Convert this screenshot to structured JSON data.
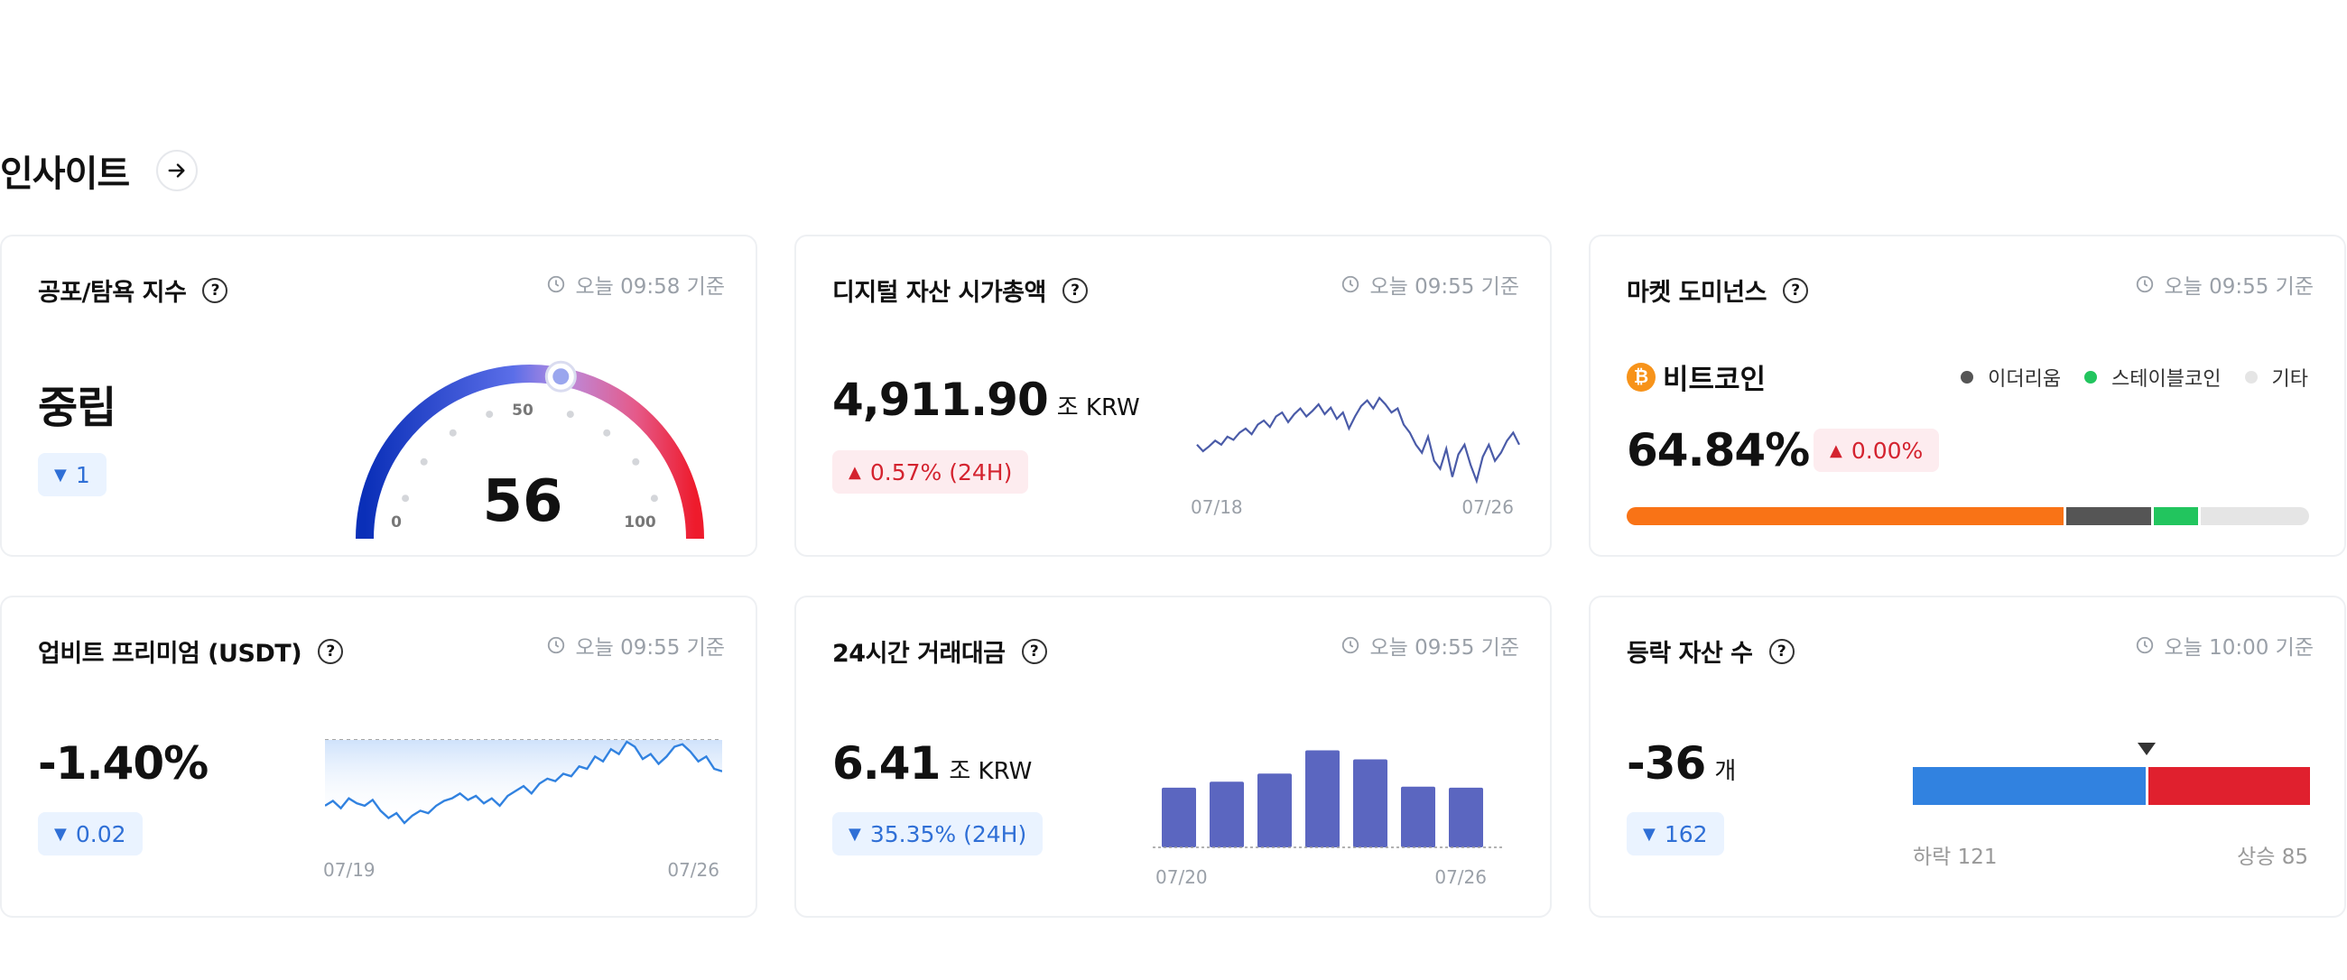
{
  "section": {
    "title": "인사이트",
    "arrow_icon": "arrow-right-icon"
  },
  "fear_greed": {
    "title": "공포/탐욕 지수",
    "timestamp": "오늘 09:58 기준",
    "state": "중립",
    "value": "56",
    "value_num": 56,
    "change": "1",
    "gauge_labels": {
      "min": "0",
      "mid": "50",
      "max": "100"
    }
  },
  "market_cap": {
    "title": "디지털 자산 시가총액",
    "timestamp": "오늘 09:55 기준",
    "value": "4,911.90",
    "unit": "조 KRW",
    "change": "0.57% (24H)",
    "x_start": "07/18",
    "x_end": "07/26"
  },
  "dominance": {
    "title": "마켓 도미넌스",
    "timestamp": "오늘 09:55 기준",
    "coin": "비트코인",
    "value": "64.84%",
    "change": "0.00%",
    "legend": [
      {
        "label": "이더리움",
        "color": "#555555"
      },
      {
        "label": "스테이블코인",
        "color": "#22c55e"
      },
      {
        "label": "기타",
        "color": "#e5e5e5"
      }
    ],
    "segments": [
      {
        "name": "비트코인",
        "share": 64.84,
        "color": "#f97316"
      },
      {
        "name": "이더리움",
        "share": 12.5,
        "color": "#555555"
      },
      {
        "name": "스테이블코인",
        "share": 6.6,
        "color": "#22c55e"
      },
      {
        "name": "기타",
        "share": 16.06,
        "color": "#e5e5e5"
      }
    ]
  },
  "premium": {
    "title": "업비트 프리미엄 (USDT)",
    "timestamp": "오늘 09:55 기준",
    "value": "-1.40%",
    "change": "0.02",
    "x_start": "07/19",
    "x_end": "07/26"
  },
  "volume": {
    "title": "24시간 거래대금",
    "timestamp": "오늘 09:55 기준",
    "value": "6.41",
    "unit": "조 KRW",
    "change": "35.35% (24H)",
    "x_start": "07/20",
    "x_end": "07/26"
  },
  "updown": {
    "title": "등락 자산 수",
    "timestamp": "오늘 10:00 기준",
    "value": "-36",
    "unit": "개",
    "change": "162",
    "down_label": "하락 121",
    "up_label": "상승 85",
    "down_count": 121,
    "up_count": 85,
    "down_color": "#3182e0",
    "up_color": "#e0202e"
  },
  "chart_data": [
    {
      "type": "line",
      "chart": "market_cap_trend",
      "x_ticks": [
        "07/18",
        "07/26"
      ],
      "y": [
        4880,
        4872,
        4878,
        4885,
        4880,
        4890,
        4886,
        4895,
        4900,
        4893,
        4905,
        4910,
        4902,
        4915,
        4920,
        4908,
        4918,
        4925,
        4915,
        4922,
        4930,
        4918,
        4926,
        4912,
        4920,
        4900,
        4915,
        4928,
        4935,
        4925,
        4938,
        4930,
        4920,
        4925,
        4905,
        4895,
        4880,
        4870,
        4890,
        4860,
        4850,
        4875,
        4840,
        4868,
        4880,
        4855,
        4835,
        4865,
        4880,
        4860,
        4870,
        4885,
        4895,
        4880
      ]
    },
    {
      "type": "area",
      "chart": "premium_trend",
      "x_ticks": [
        "07/19",
        "07/26"
      ],
      "y": [
        -2.1,
        -2.0,
        -2.15,
        -1.95,
        -2.05,
        -2.1,
        -1.98,
        -2.2,
        -2.35,
        -2.25,
        -2.45,
        -2.3,
        -2.2,
        -2.25,
        -2.1,
        -2.0,
        -1.95,
        -1.85,
        -1.98,
        -1.9,
        -2.05,
        -1.95,
        -2.1,
        -1.9,
        -1.8,
        -1.7,
        -1.85,
        -1.65,
        -1.55,
        -1.6,
        -1.45,
        -1.5,
        -1.3,
        -1.35,
        -1.1,
        -1.2,
        -0.95,
        -1.05,
        -0.8,
        -0.9,
        -1.15,
        -1.05,
        -1.25,
        -1.1,
        -0.9,
        -0.85,
        -1.0,
        -1.2,
        -1.1,
        -1.35,
        -1.4
      ],
      "ref_line": "dashed-top"
    },
    {
      "type": "bar",
      "chart": "volume_trend",
      "x_ticks": [
        "07/20",
        "07/26"
      ],
      "values": [
        5.9,
        6.5,
        7.3,
        9.6,
        8.7,
        6.0,
        5.9
      ]
    }
  ],
  "colors": {
    "down": "#2f6fd6",
    "up": "#d4232f",
    "accent_bar": "#5b66c0",
    "line": "#4a5ba8",
    "premium_line": "#3182e0"
  }
}
